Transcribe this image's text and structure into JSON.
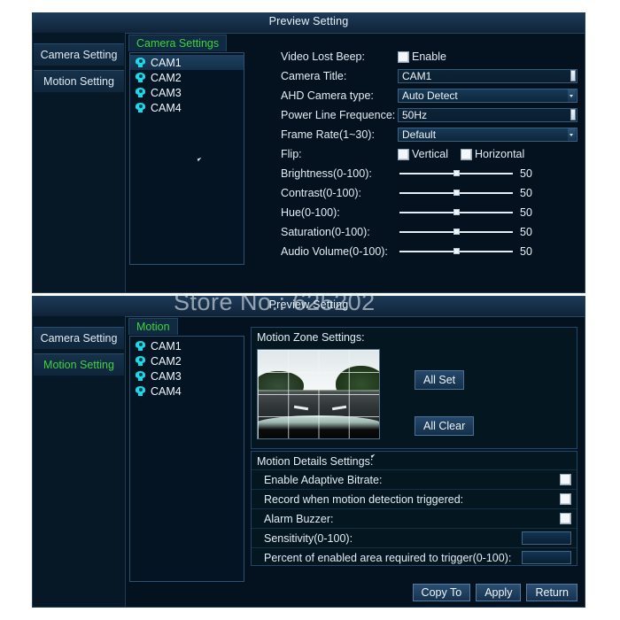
{
  "window_camera": {
    "title": "Preview Setting",
    "nav": [
      {
        "label": "Camera Setting",
        "active": false
      },
      {
        "label": "Motion Setting",
        "active": false
      }
    ],
    "tab_label": "Camera Settings",
    "cameras": [
      "CAM1",
      "CAM2",
      "CAM3",
      "CAM4"
    ],
    "selected_camera": "CAM1",
    "fields": {
      "video_lost_beep_label": "Video Lost Beep:",
      "video_lost_beep_checkbox_label": "Enable",
      "camera_title_label": "Camera Title:",
      "camera_title_value": "CAM1",
      "ahd_type_label": "AHD Camera type:",
      "ahd_type_value": "Auto Detect",
      "power_line_label": "Power Line Frequence:",
      "power_line_value": "50Hz",
      "frame_rate_label": "Frame Rate(1~30):",
      "frame_rate_value": "Default",
      "flip_label": "Flip:",
      "flip_vertical_label": "Vertical",
      "flip_horizontal_label": "Horizontal"
    },
    "sliders": [
      {
        "label": "Brightness(0-100):",
        "value": "50",
        "percent": 50
      },
      {
        "label": "Contrast(0-100):",
        "value": "50",
        "percent": 50
      },
      {
        "label": "Hue(0-100):",
        "value": "50",
        "percent": 50
      },
      {
        "label": "Saturation(0-100):",
        "value": "50",
        "percent": 50
      },
      {
        "label": "Audio Volume(0-100):",
        "value": "50",
        "percent": 50
      }
    ]
  },
  "window_motion": {
    "title": "Preview Setting",
    "watermark": "Store No.: 625202",
    "nav": [
      {
        "label": "Camera Setting",
        "active": false
      },
      {
        "label": "Motion Setting",
        "active": true
      }
    ],
    "tab_label": "Motion",
    "cameras": [
      "CAM1",
      "CAM2",
      "CAM3",
      "CAM4"
    ],
    "selected_camera": "",
    "zone": {
      "title": "Motion Zone Settings:",
      "all_set_label": "All Set",
      "all_clear_label": "All Clear",
      "grid_rows": 4,
      "grid_cols": 4
    },
    "details": {
      "title": "Motion Details Settings:",
      "rows": [
        {
          "label": "Enable Adaptive Bitrate:",
          "control": "checkbox",
          "checked": false
        },
        {
          "label": "Record when motion detection triggered:",
          "control": "checkbox",
          "checked": false
        },
        {
          "label": "Alarm Buzzer:",
          "control": "checkbox",
          "checked": false
        },
        {
          "label": "Sensitivity(0-100):",
          "control": "input",
          "value": ""
        },
        {
          "label": "Percent of enabled area required to trigger(0-100):",
          "control": "input",
          "value": ""
        }
      ]
    },
    "buttons": [
      {
        "label": "Copy To"
      },
      {
        "label": "Apply"
      },
      {
        "label": "Return"
      }
    ]
  },
  "colors": {
    "window_bg": "#04121f",
    "titlebar": "#17304a",
    "accent_green": "#3fd23f",
    "border": "#20425f",
    "text": "#e3edf5",
    "camera_icon": "#1ad9e8",
    "page_bg": "#ffffff"
  }
}
